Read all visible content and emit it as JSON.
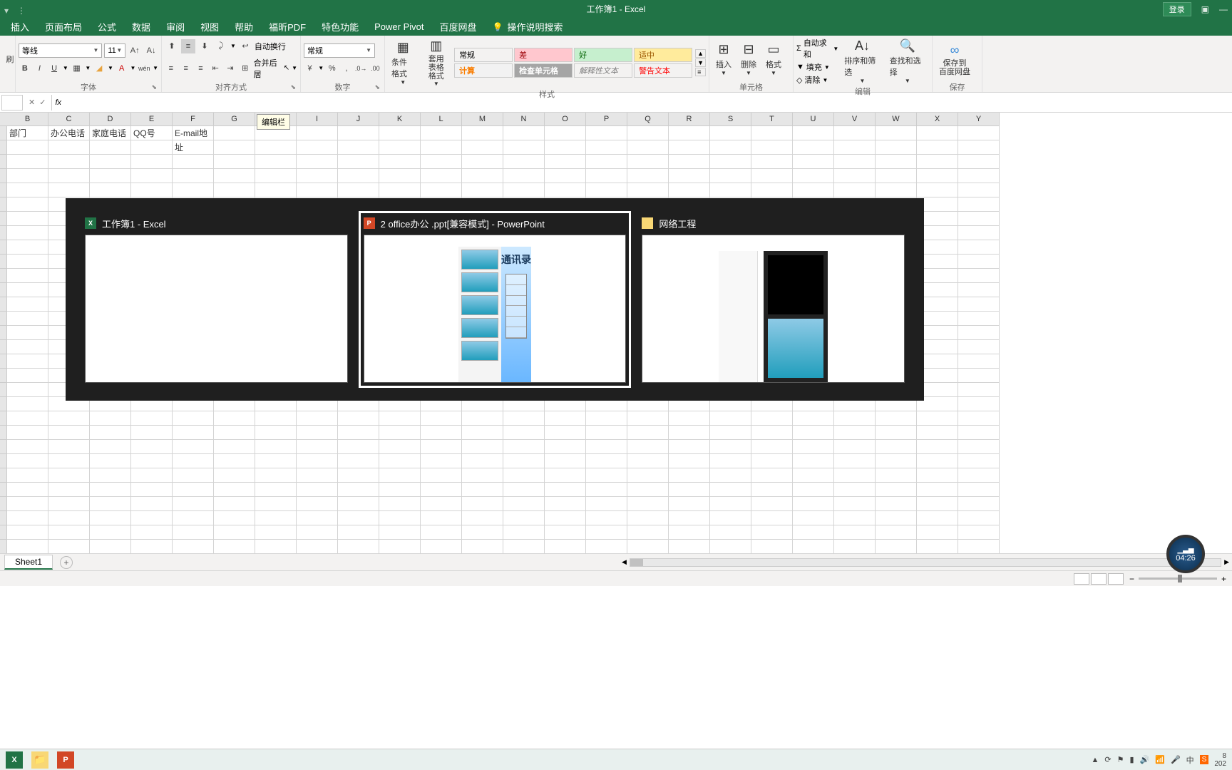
{
  "titlebar": {
    "title": "工作簿1  -  Excel",
    "login": "登录"
  },
  "tabs": {
    "insert": "插入",
    "layout": "页面布局",
    "formulas": "公式",
    "data": "数据",
    "review": "审阅",
    "view": "视图",
    "help": "帮助",
    "foxit": "福昕PDF",
    "special": "特色功能",
    "powerpivot": "Power Pivot",
    "baidu": "百度网盘",
    "tellme": "操作说明搜索"
  },
  "ribbon": {
    "font": {
      "name": "等线",
      "size": "11",
      "label": "字体"
    },
    "alignment": {
      "wrap": "自动换行",
      "merge": "合并后居",
      "label": "对齐方式"
    },
    "number": {
      "format": "常规",
      "label": "数字"
    },
    "styles": {
      "cond": "条件格式",
      "table": "套用\n表格格式",
      "normal": "常规",
      "bad": "差",
      "good": "好",
      "neutral": "适中",
      "calc": "计算",
      "check": "检查单元格",
      "explain": "解释性文本",
      "warn": "警告文本",
      "label": "样式"
    },
    "cells": {
      "insert": "插入",
      "delete": "删除",
      "format": "格式",
      "label": "单元格"
    },
    "editing": {
      "autosum": "自动求和",
      "fill": "填充",
      "clear": "清除",
      "sort": "排序和筛选",
      "find": "查找和选择",
      "label": "编辑"
    },
    "save": {
      "baidu": "保存到\n百度网盘",
      "label": "保存"
    }
  },
  "tooltip": "编辑栏",
  "columns": [
    "B",
    "C",
    "D",
    "E",
    "F",
    "G",
    "H",
    "I",
    "J",
    "K",
    "L",
    "M",
    "N",
    "O",
    "P",
    "Q",
    "R",
    "S",
    "T",
    "U",
    "V",
    "W",
    "X",
    "Y"
  ],
  "row1": {
    "b": "部门",
    "c": "办公电话",
    "d": "家庭电话",
    "e": "QQ号",
    "f": "E-mail地址"
  },
  "sheet": {
    "name": "Sheet1"
  },
  "alttab": {
    "excel": "工作簿1 - Excel",
    "ppt": "2 office办公 .ppt[兼容模式] - PowerPoint",
    "explorer": "网络工程",
    "slide_title": "通讯录"
  },
  "timer": "04:26",
  "tray": {
    "year": "202"
  }
}
